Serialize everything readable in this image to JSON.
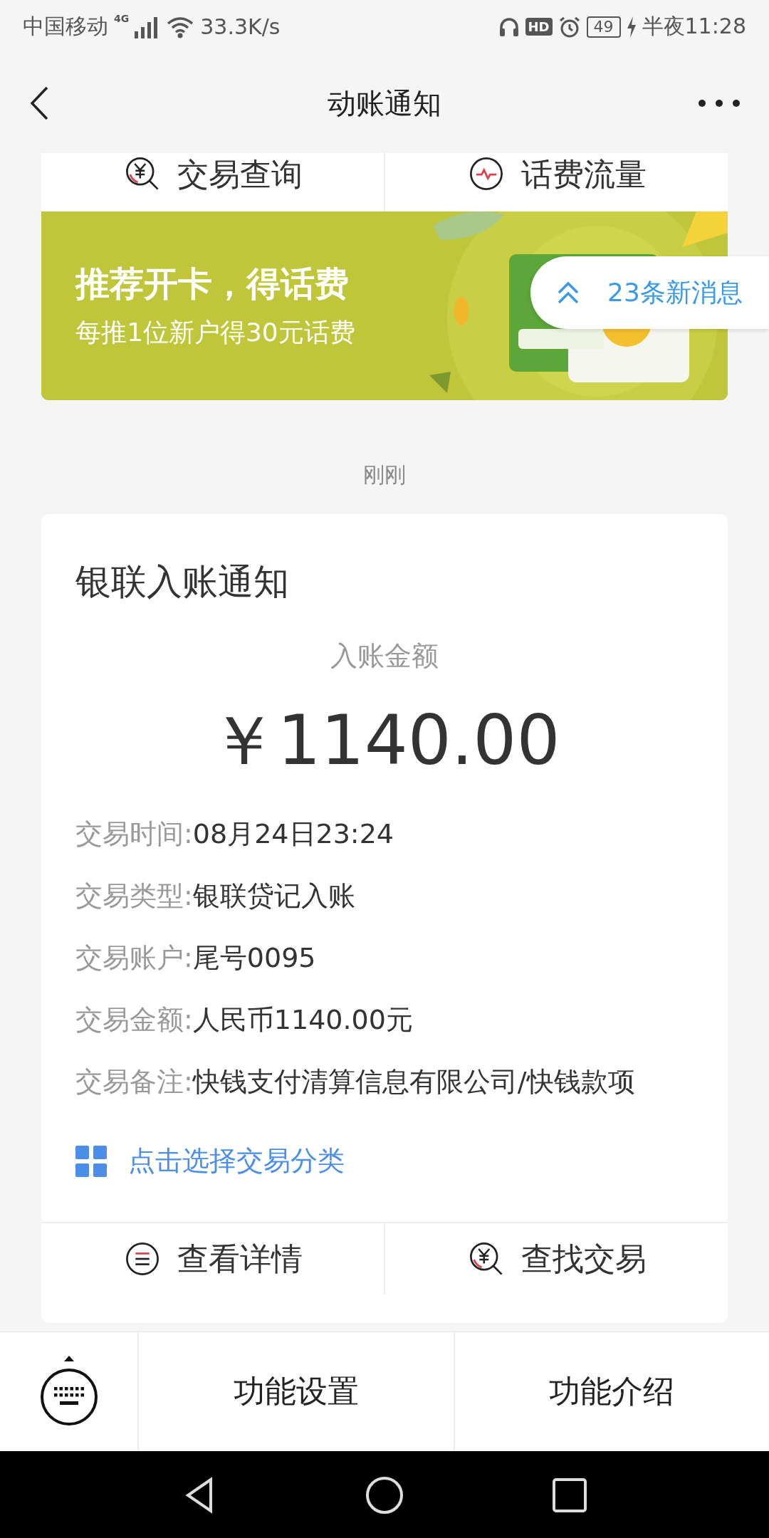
{
  "status_bar": {
    "carrier": "中国移动",
    "network": "4G",
    "speed": "33.3K/s",
    "hd_badge": "HD",
    "battery": "49",
    "time": "半夜11:28"
  },
  "header": {
    "title": "动账通知"
  },
  "top_actions": [
    {
      "kind": "yen-search",
      "label": "交易查询"
    },
    {
      "kind": "pulse",
      "label": "话费流量"
    }
  ],
  "banner": {
    "title": "推荐开卡，得话费",
    "subtitle": "每推1位新户得30元话费"
  },
  "new_messages": "23条新消息",
  "timestamp": "刚刚",
  "card": {
    "title": "银联入账通知",
    "amount_label": "入账金额",
    "amount": "￥1140.00",
    "details": [
      {
        "label": "交易时间:",
        "value": "08月24日23:24"
      },
      {
        "label": "交易类型:",
        "value": "银联贷记入账"
      },
      {
        "label": "交易账户:",
        "value": "尾号0095"
      },
      {
        "label": "交易金额:",
        "value": "人民币1140.00元"
      },
      {
        "label": "交易备注:",
        "value": "快钱支付清算信息有限公司/快钱款项"
      }
    ],
    "category_link": "点击选择交易分类",
    "actions": [
      {
        "kind": "list",
        "label": "查看详情"
      },
      {
        "kind": "yen-search",
        "label": "查找交易"
      }
    ]
  },
  "bottom_bar": {
    "items": [
      "功能设置",
      "功能介绍"
    ]
  }
}
